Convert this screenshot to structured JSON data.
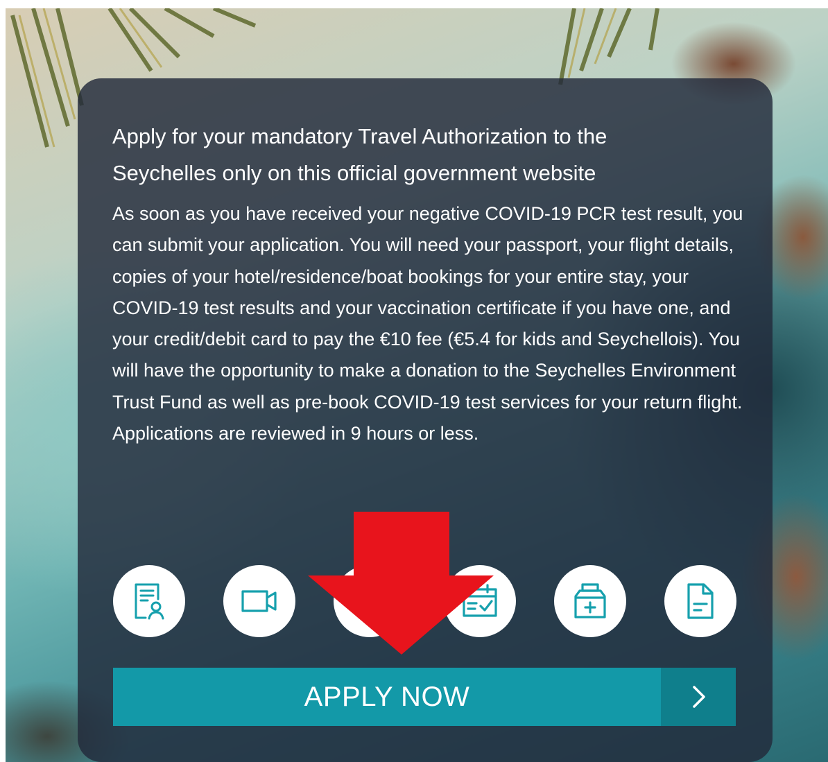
{
  "hero": {
    "headline": "Apply for your mandatory Travel Authorization to the Seychelles only on this official government website",
    "body": "As soon as you have received your negative COVID-19 PCR test result, you can submit your application. You will need your passport, your flight details, copies of your hotel/residence/boat bookings for your entire stay, your COVID-19 test results and your vaccination certificate if you have one, and your credit/debit card to pay the €10 fee (€5.4 for kids and Seychellois). You will have the opportunity to make a donation to the Seychelles Environment Trust Fund as well as pre-book COVID-19 test services for your return flight. Applications are reviewed in 9 hours or less."
  },
  "steps": [
    {
      "icon": "passport-document-icon"
    },
    {
      "icon": "video-camera-icon"
    },
    {
      "icon": "flight-icon"
    },
    {
      "icon": "calendar-check-icon"
    },
    {
      "icon": "medical-kit-icon"
    },
    {
      "icon": "document-icon"
    }
  ],
  "apply_button": {
    "label": "APPLY NOW",
    "icon": "chevron-right-icon"
  },
  "colors": {
    "panel": "#222a3a",
    "button": "#1399a8",
    "button_chevron_bg": "#0f7f8c",
    "icon_stroke": "#16a0ad",
    "arrow": "#e8141c"
  }
}
